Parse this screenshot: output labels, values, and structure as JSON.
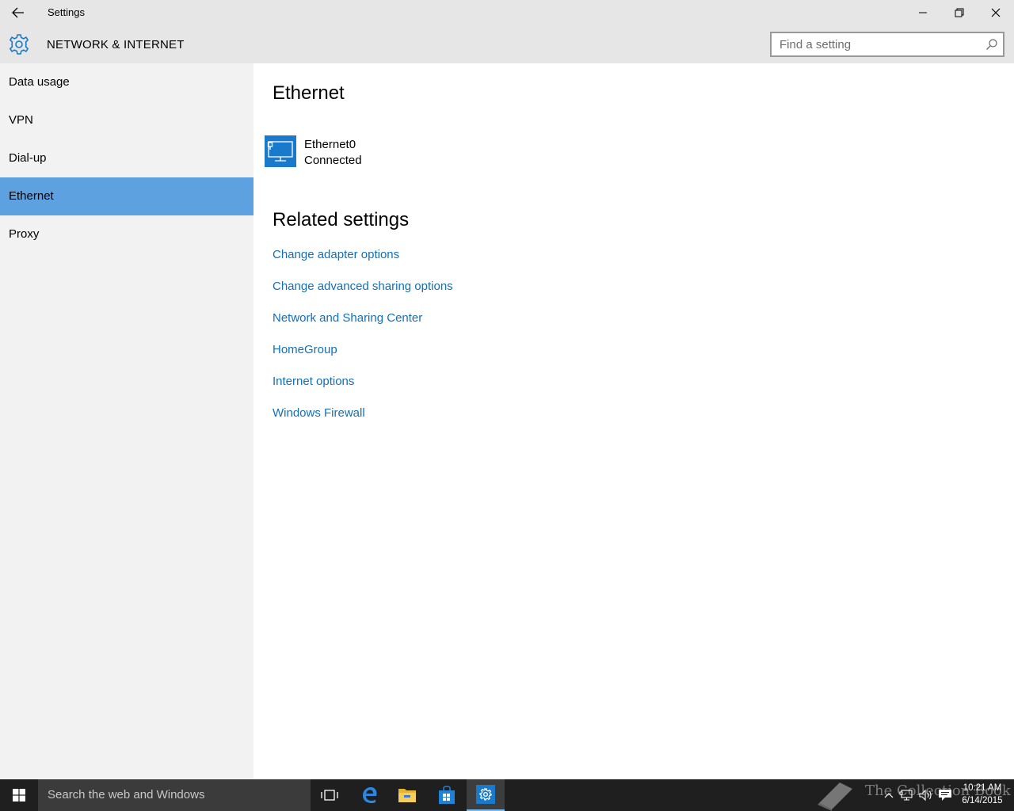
{
  "window": {
    "title": "Settings",
    "controls": [
      "minimize",
      "maximize",
      "close"
    ]
  },
  "header": {
    "section_title": "NETWORK & INTERNET",
    "search_placeholder": "Find a setting"
  },
  "sidebar": {
    "items": [
      {
        "label": "Data usage",
        "selected": false
      },
      {
        "label": "VPN",
        "selected": false
      },
      {
        "label": "Dial-up",
        "selected": false
      },
      {
        "label": "Ethernet",
        "selected": true
      },
      {
        "label": "Proxy",
        "selected": false
      }
    ]
  },
  "main": {
    "title": "Ethernet",
    "connection": {
      "name": "Ethernet0",
      "status": "Connected",
      "icon": "network-monitor-icon"
    },
    "related_title": "Related settings",
    "links": [
      "Change adapter options",
      "Change advanced sharing options",
      "Network and Sharing Center",
      "HomeGroup",
      "Internet options",
      "Windows Firewall"
    ]
  },
  "taskbar": {
    "search_placeholder": "Search the web and Windows",
    "pinned": [
      "task-view-icon",
      "edge-icon",
      "file-explorer-icon",
      "store-icon",
      "settings-icon"
    ],
    "tray": [
      "chevron-up-icon",
      "network-icon",
      "volume-icon",
      "action-center-icon"
    ],
    "time": "10:21 AM",
    "date": "6/14/2015",
    "watermark": "The Collection Book"
  },
  "colors": {
    "accent": "#1979ca",
    "selected_nav": "#5ea1e0",
    "link": "#1070c0",
    "chrome_bg": "#e6e6e6",
    "sidebar_bg": "#f2f2f2",
    "taskbar_bg": "#1f1f1f"
  }
}
